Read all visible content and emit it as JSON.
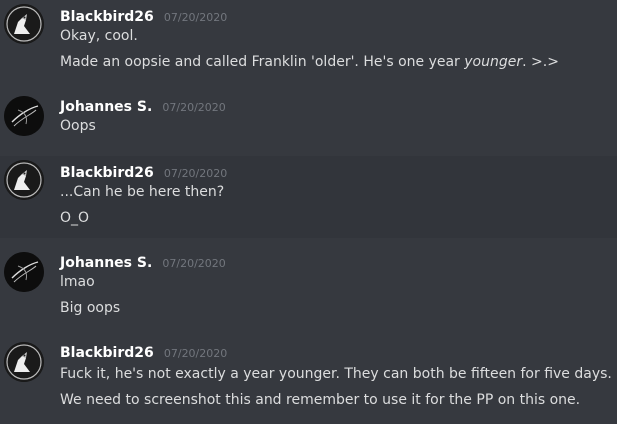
{
  "messages": [
    {
      "author": "Blackbird26",
      "timestamp": "07/20/2020",
      "lines": [
        "Okay, cool.",
        {
          "before": "Made an oopsie and called Franklin 'older'. He's one year ",
          "emph": "younger",
          "after": ". >.>"
        }
      ]
    },
    {
      "author": "Johannes S.",
      "timestamp": "07/20/2020",
      "lines": [
        "Oops"
      ]
    },
    {
      "author": "Blackbird26",
      "timestamp": "07/20/2020",
      "lines": [
        "...Can he be here then?",
        "O_O"
      ]
    },
    {
      "author": "Johannes S.",
      "timestamp": "07/20/2020",
      "lines": [
        "lmao",
        "Big oops"
      ]
    },
    {
      "author": "Blackbird26",
      "timestamp": "07/20/2020",
      "lines": [
        "Fuck it, he's not exactly a year younger. They can both be fifteen for five days.",
        "We need to screenshot this and remember to use it for the PP on this one."
      ]
    }
  ],
  "colors": {
    "background": "#36393f",
    "highlight": "#32353b",
    "username": "#ffffff",
    "timestamp": "#72767d",
    "text": "#dcddde"
  }
}
